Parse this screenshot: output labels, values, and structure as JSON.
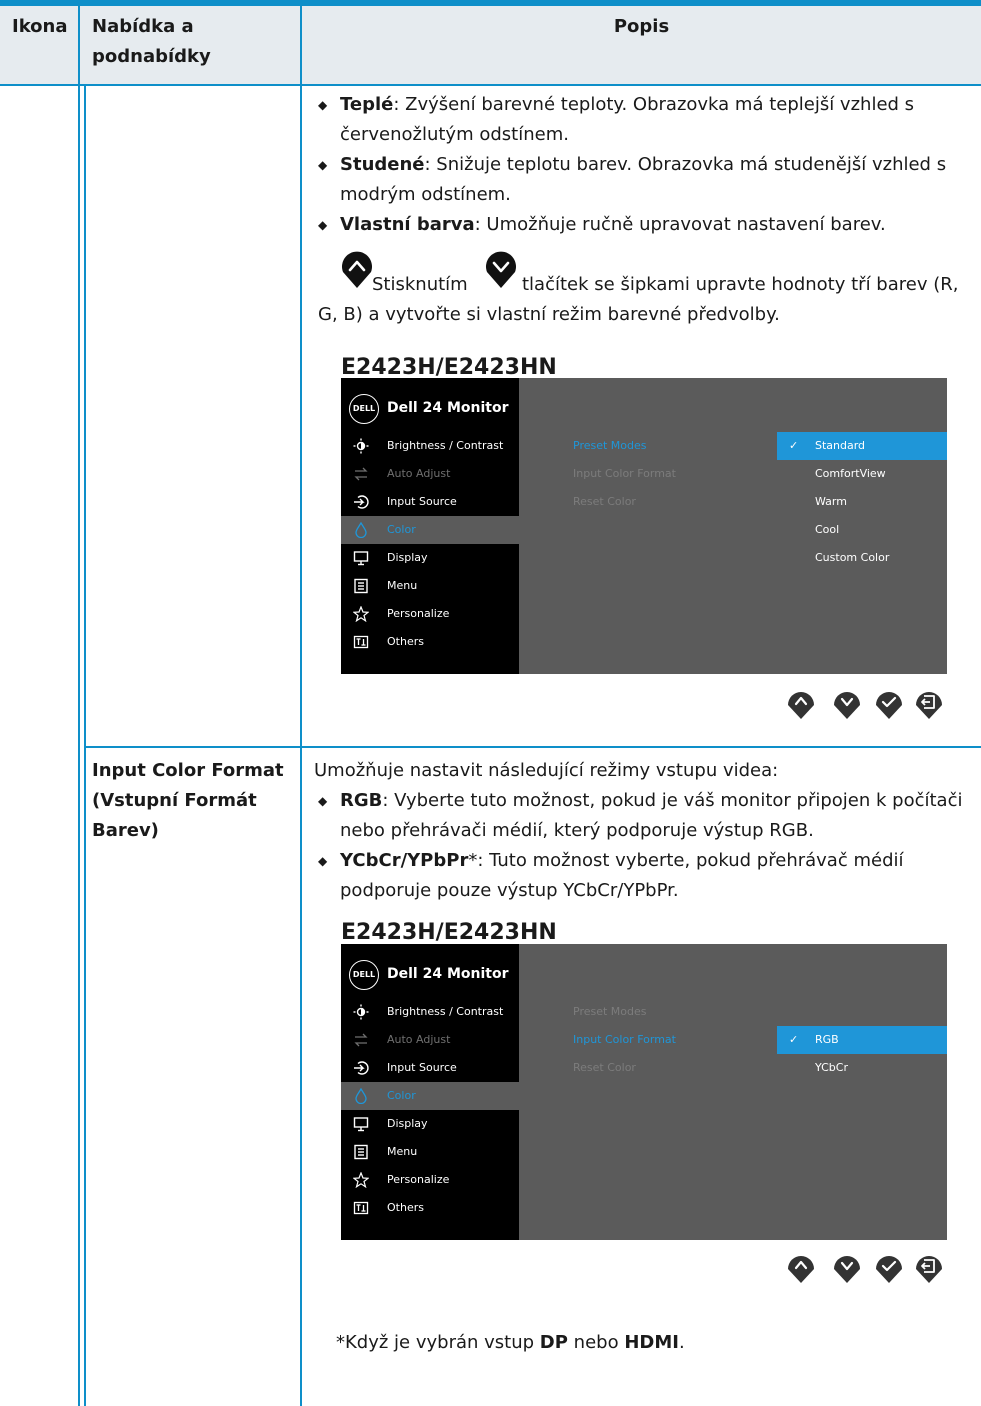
{
  "header": {
    "col_icon": "Ikona",
    "col_menu_line1": "Nabídka a",
    "col_menu_line2": "podnabídky",
    "col_desc": "Popis"
  },
  "section1": {
    "bullets": [
      {
        "term": "Teplé",
        "line1": ": Zvýšení barevné teploty. Obrazovka má teplejší vzhled s",
        "line2": "červenožlutým odstínem."
      },
      {
        "term": "Studené",
        "line1": ": Snižuje teplotu barev. Obrazovka má studenější vzhled s",
        "line2": "modrým odstínem."
      },
      {
        "term": "Vlastní barva",
        "line1": ": Umožňuje ručně upravovat nastavení barev.",
        "line2": ""
      }
    ],
    "instr_pre": "Stisknutím",
    "instr_post": "tlačítek se šipkami upravte hodnoty tří barev (R,",
    "instr_line2": "G, B) a vytvořte si vlastní režim barevné předvolby.",
    "model": "E2423H/E2423HN"
  },
  "section2": {
    "menu_line1": "Input Color Format",
    "menu_line2": "(Vstupní Formát",
    "menu_line3": "Barev)",
    "intro": "Umožňuje nastavit následující režimy vstupu videa:",
    "bullets": [
      {
        "term": "RGB",
        "line1": ": Vyberte tuto možnost, pokud je váš monitor připojen k počítači",
        "line2": "nebo přehrávači médií, který podporuje výstup RGB."
      },
      {
        "term": "YCbCr/YPbPr",
        "line1": ": Tuto možnost vyberte, pokud přehrávač médií",
        "line2": "podporuje pouze výstup YCbCr/YPbPr.",
        "mark": "*"
      }
    ],
    "model": "E2423H/E2423HN",
    "footnote_mark": "*",
    "footnote_pre": "Když je vybrán vstup ",
    "footnote_dp": "DP",
    "footnote_mid": " nebo ",
    "footnote_hdmi": "HDMI",
    "footnote_end": "."
  },
  "osd": {
    "logo": "DELL",
    "title": "Dell 24 Monitor",
    "menu_items": [
      "Brightness / Contrast",
      "Auto Adjust",
      "Input Source",
      "Color",
      "Display",
      "Menu",
      "Personalize",
      "Others"
    ],
    "submenu": [
      "Preset Modes",
      "Input Color Format",
      "Reset Color"
    ],
    "options1": [
      "Standard",
      "ComfortView",
      "Warm",
      "Cool",
      "Custom Color"
    ],
    "options2": [
      "RGB",
      "YCbCr"
    ]
  },
  "colors": {
    "accent": "#0e8fc9",
    "osd_highlight": "#1f96d8",
    "header_bg": "#e6ebef"
  }
}
